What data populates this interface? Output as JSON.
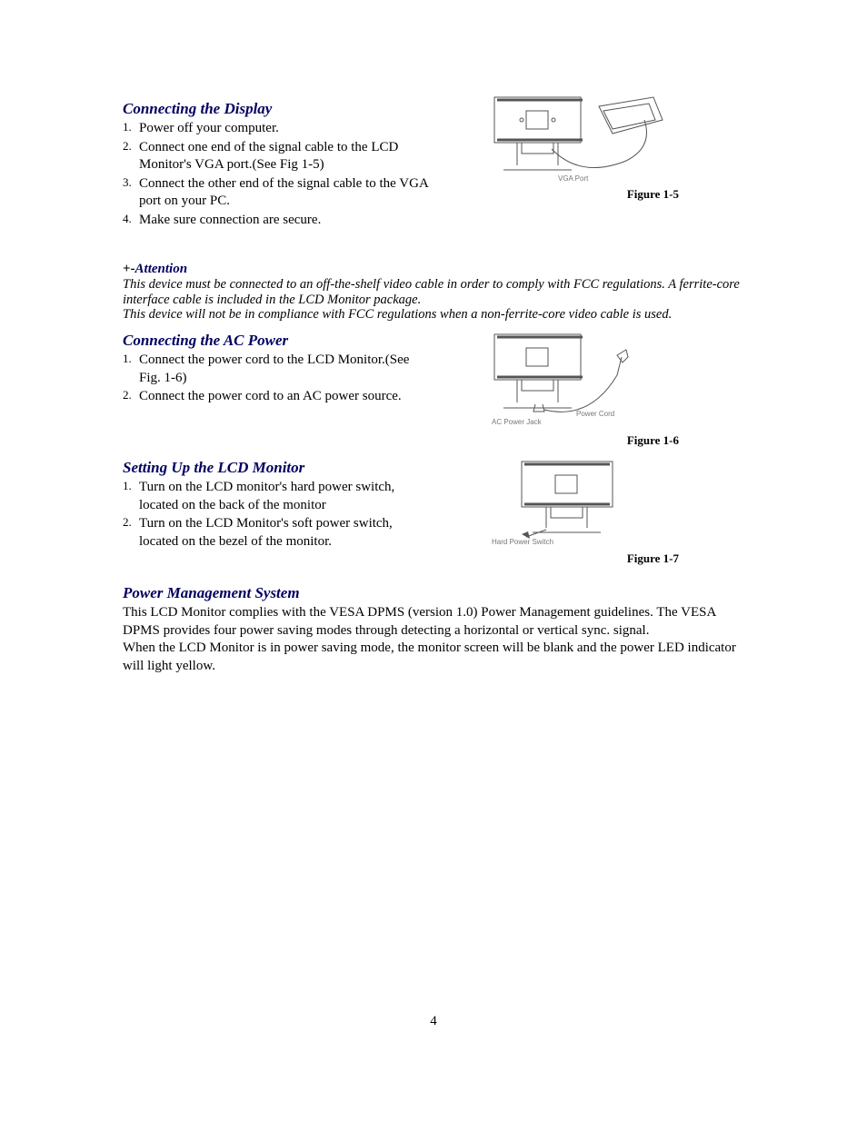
{
  "section1": {
    "heading": "Connecting the Display",
    "items": [
      "Power off your computer.",
      "Connect one end of the signal cable to the LCD Monitor's VGA port.(See Fig 1-5)",
      "Connect the other end of the signal cable to the VGA port   on your PC.",
      "Make sure connection are secure."
    ],
    "figure_label": "VGA Port",
    "figure_caption": "Figure 1-5"
  },
  "attention": {
    "lead": "+-",
    "title": "Attention",
    "body1": "This device must be connected to an off-the-shelf video cable in order to comply with FCC regulations. A ferrite-core interface cable is included in the LCD Monitor package.",
    "body2": "This device will not be in compliance with FCC regulations when a non-ferrite-core video cable is used."
  },
  "section2": {
    "heading": "Connecting the AC Power",
    "items": [
      "Connect the power cord to the LCD Monitor.(See Fig. 1-6)",
      "Connect the power cord to an AC power source."
    ],
    "figure_label1": "AC Power Jack",
    "figure_label2": "Power Cord",
    "figure_caption": "Figure 1-6"
  },
  "section3": {
    "heading": "Setting Up the LCD Monitor",
    "items": [
      "Turn on the LCD monitor's hard power switch, located on the back of the monitor",
      "Turn on the LCD Monitor's soft power switch, located on the bezel of the monitor."
    ],
    "figure_label": "Hard Power Switch",
    "figure_caption": "Figure 1-7"
  },
  "section4": {
    "heading": "Power Management System",
    "body1": "This LCD Monitor complies with the VESA DPMS (version 1.0) Power Management guidelines. The VESA DPMS provides four power saving modes through detecting a horizontal or vertical sync. signal.",
    "body2": "When the LCD Monitor is in power saving mode, the monitor screen will be blank and the power LED indicator will light yellow."
  },
  "page_number": "4"
}
